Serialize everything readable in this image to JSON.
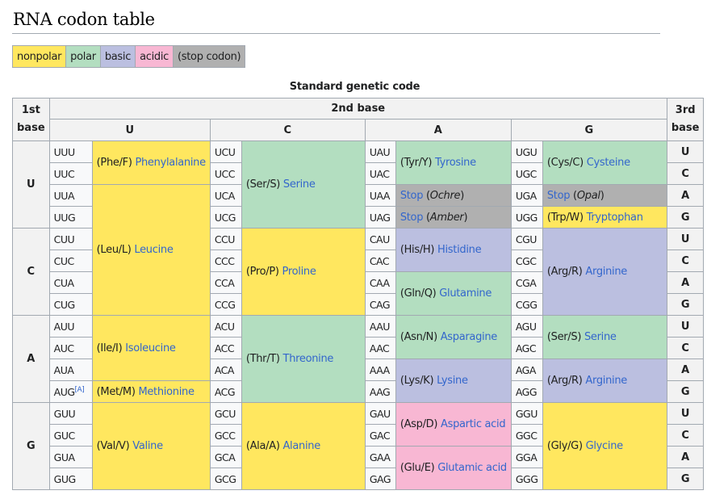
{
  "title": "RNA codon table",
  "legend": [
    {
      "label": "nonpolar",
      "class": "nonpolar",
      "color": "#ffe75f"
    },
    {
      "label": "polar",
      "class": "polar",
      "color": "#b3dec0"
    },
    {
      "label": "basic",
      "class": "basic",
      "color": "#bbbfe0"
    },
    {
      "label": "acidic",
      "class": "acidic",
      "color": "#f8b7d3"
    },
    {
      "label": "(stop codon)",
      "class": "stop",
      "color": "#b0b0b0"
    }
  ],
  "table": {
    "caption": "Standard genetic code",
    "header": {
      "first_base": [
        "1st",
        "base"
      ],
      "second_base": "2nd base",
      "third_base": [
        "3rd",
        "base"
      ],
      "second_base_columns": [
        "U",
        "C",
        "A",
        "G"
      ]
    },
    "footnote_marker": "[A]",
    "rows": [
      {
        "first": "U",
        "third": "U",
        "codons": [
          "UUU",
          "UCU",
          "UAU",
          "UGU"
        ]
      },
      {
        "first": "U",
        "third": "C",
        "codons": [
          "UUC",
          "UCC",
          "UAC",
          "UGC"
        ]
      },
      {
        "first": "U",
        "third": "A",
        "codons": [
          "UUA",
          "UCA",
          "UAA",
          "UGA"
        ]
      },
      {
        "first": "U",
        "third": "G",
        "codons": [
          "UUG",
          "UCG",
          "UAG",
          "UGG"
        ]
      },
      {
        "first": "C",
        "third": "U",
        "codons": [
          "CUU",
          "CCU",
          "CAU",
          "CGU"
        ]
      },
      {
        "first": "C",
        "third": "C",
        "codons": [
          "CUC",
          "CCC",
          "CAC",
          "CGC"
        ]
      },
      {
        "first": "C",
        "third": "A",
        "codons": [
          "CUA",
          "CCA",
          "CAA",
          "CGA"
        ]
      },
      {
        "first": "C",
        "third": "G",
        "codons": [
          "CUG",
          "CCG",
          "CAG",
          "CGG"
        ]
      },
      {
        "first": "A",
        "third": "U",
        "codons": [
          "AUU",
          "ACU",
          "AAU",
          "AGU"
        ]
      },
      {
        "first": "A",
        "third": "C",
        "codons": [
          "AUC",
          "ACC",
          "AAC",
          "AGC"
        ]
      },
      {
        "first": "A",
        "third": "A",
        "codons": [
          "AUA",
          "ACA",
          "AAA",
          "AGA"
        ]
      },
      {
        "first": "A",
        "third": "G",
        "codons": [
          "AUG",
          "ACG",
          "AAG",
          "AGG"
        ]
      },
      {
        "first": "G",
        "third": "U",
        "codons": [
          "GUU",
          "GCU",
          "GAU",
          "GGU"
        ]
      },
      {
        "first": "G",
        "third": "C",
        "codons": [
          "GUC",
          "GCC",
          "GAC",
          "GGC"
        ]
      },
      {
        "first": "G",
        "third": "A",
        "codons": [
          "GUA",
          "GCA",
          "GAA",
          "GGA"
        ]
      },
      {
        "first": "G",
        "third": "G",
        "codons": [
          "GUG",
          "GCG",
          "GAG",
          "GGG"
        ]
      }
    ],
    "amino_acids": [
      {
        "col": 0,
        "start": 0,
        "span": 2,
        "class": "nonpolar",
        "abbr": "(Phe/F)",
        "name": "Phenylalanine"
      },
      {
        "col": 0,
        "start": 2,
        "span": 6,
        "class": "nonpolar",
        "abbr": "(Leu/L)",
        "name": "Leucine"
      },
      {
        "col": 0,
        "start": 8,
        "span": 3,
        "class": "nonpolar",
        "abbr": "(Ile/I)",
        "name": "Isoleucine"
      },
      {
        "col": 0,
        "start": 11,
        "span": 1,
        "class": "nonpolar",
        "abbr": "(Met/M)",
        "name": "Methionine"
      },
      {
        "col": 0,
        "start": 12,
        "span": 4,
        "class": "nonpolar",
        "abbr": "(Val/V)",
        "name": "Valine"
      },
      {
        "col": 1,
        "start": 0,
        "span": 4,
        "class": "polar",
        "abbr": "(Ser/S)",
        "name": "Serine"
      },
      {
        "col": 1,
        "start": 4,
        "span": 4,
        "class": "nonpolar",
        "abbr": "(Pro/P)",
        "name": "Proline"
      },
      {
        "col": 1,
        "start": 8,
        "span": 4,
        "class": "polar",
        "abbr": "(Thr/T)",
        "name": "Threonine"
      },
      {
        "col": 1,
        "start": 12,
        "span": 4,
        "class": "nonpolar",
        "abbr": "(Ala/A)",
        "name": "Alanine"
      },
      {
        "col": 2,
        "start": 0,
        "span": 2,
        "class": "polar",
        "abbr": "(Tyr/Y)",
        "name": "Tyrosine"
      },
      {
        "col": 2,
        "start": 2,
        "span": 1,
        "class": "stop",
        "stop": "Stop",
        "variant": "Ochre"
      },
      {
        "col": 2,
        "start": 3,
        "span": 1,
        "class": "stop",
        "stop": "Stop",
        "variant": "Amber"
      },
      {
        "col": 2,
        "start": 4,
        "span": 2,
        "class": "basic",
        "abbr": "(His/H)",
        "name": "Histidine"
      },
      {
        "col": 2,
        "start": 6,
        "span": 2,
        "class": "polar",
        "abbr": "(Gln/Q)",
        "name": "Glutamine"
      },
      {
        "col": 2,
        "start": 8,
        "span": 2,
        "class": "polar",
        "abbr": "(Asn/N)",
        "name": "Asparagine"
      },
      {
        "col": 2,
        "start": 10,
        "span": 2,
        "class": "basic",
        "abbr": "(Lys/K)",
        "name": "Lysine"
      },
      {
        "col": 2,
        "start": 12,
        "span": 2,
        "class": "acidic",
        "abbr": "(Asp/D)",
        "name": "Aspartic acid"
      },
      {
        "col": 2,
        "start": 14,
        "span": 2,
        "class": "acidic",
        "abbr": "(Glu/E)",
        "name": "Glutamic acid"
      },
      {
        "col": 3,
        "start": 0,
        "span": 2,
        "class": "polar",
        "abbr": "(Cys/C)",
        "name": "Cysteine"
      },
      {
        "col": 3,
        "start": 2,
        "span": 1,
        "class": "stop",
        "stop": "Stop",
        "variant": "Opal"
      },
      {
        "col": 3,
        "start": 3,
        "span": 1,
        "class": "nonpolar",
        "abbr": "(Trp/W)",
        "name": "Tryptophan"
      },
      {
        "col": 3,
        "start": 4,
        "span": 4,
        "class": "basic",
        "abbr": "(Arg/R)",
        "name": "Arginine"
      },
      {
        "col": 3,
        "start": 8,
        "span": 2,
        "class": "polar",
        "abbr": "(Ser/S)",
        "name": "Serine"
      },
      {
        "col": 3,
        "start": 10,
        "span": 2,
        "class": "basic",
        "abbr": "(Arg/R)",
        "name": "Arginine"
      },
      {
        "col": 3,
        "start": 12,
        "span": 4,
        "class": "nonpolar",
        "abbr": "(Gly/G)",
        "name": "Glycine"
      }
    ]
  }
}
